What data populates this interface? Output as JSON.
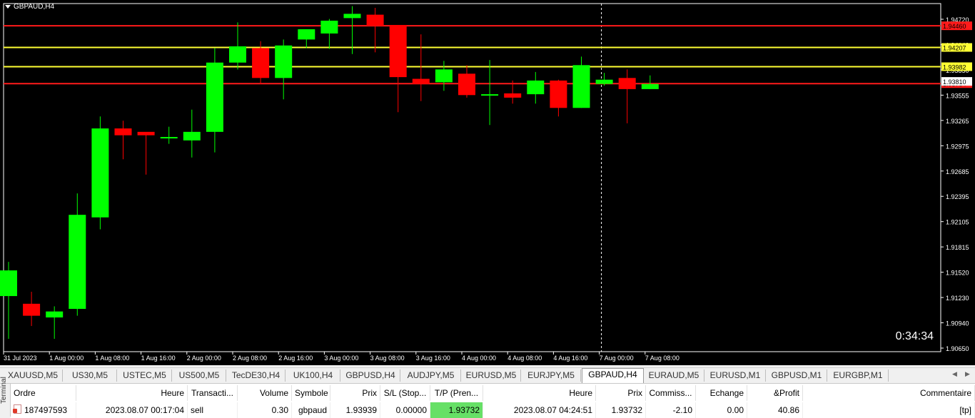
{
  "chart": {
    "symbol_title": "GBPAUD,H4",
    "countdown": "0:34:34",
    "colors": {
      "background": "#000000",
      "bull": "#00ff00",
      "bear": "#ff0000",
      "grid": "#ffffff",
      "red_line": "#ff1a1a",
      "yellow_line": "#ffff33"
    }
  },
  "chart_data": {
    "type": "candlestick",
    "price_min": 1.9065,
    "price_max": 1.9472,
    "y_ticks": [
      "1.94720",
      "1.94140",
      "1.93850",
      "1.93555",
      "1.93265",
      "1.92975",
      "1.92685",
      "1.92395",
      "1.92105",
      "1.91815",
      "1.91520",
      "1.91230",
      "1.90940",
      "1.90650"
    ],
    "x_labels": [
      "31 Jul 2023",
      "1 Aug 00:00",
      "1 Aug 08:00",
      "1 Aug 16:00",
      "2 Aug 00:00",
      "2 Aug 08:00",
      "2 Aug 16:00",
      "3 Aug 00:00",
      "3 Aug 08:00",
      "3 Aug 16:00",
      "4 Aug 00:00",
      "4 Aug 08:00",
      "4 Aug 16:00",
      "7 Aug 00:00",
      "7 Aug 08:00"
    ],
    "candles": [
      {
        "o": 1.913,
        "h": 1.917,
        "l": 1.908,
        "c": 1.916
      },
      {
        "o": 1.9121,
        "h": 1.9135,
        "l": 1.9095,
        "c": 1.9107
      },
      {
        "o": 1.9105,
        "h": 1.9118,
        "l": 1.908,
        "c": 1.9112
      },
      {
        "o": 1.9115,
        "h": 1.925,
        "l": 1.9107,
        "c": 1.9225
      },
      {
        "o": 1.9222,
        "h": 1.934,
        "l": 1.9208,
        "c": 1.9326
      },
      {
        "o": 1.9326,
        "h": 1.9335,
        "l": 1.929,
        "c": 1.9318
      },
      {
        "o": 1.9322,
        "h": 1.932,
        "l": 1.9272,
        "c": 1.9318
      },
      {
        "o": 1.9315,
        "h": 1.9328,
        "l": 1.9308,
        "c": 1.9316
      },
      {
        "o": 1.9312,
        "h": 1.9348,
        "l": 1.9292,
        "c": 1.9322
      },
      {
        "o": 1.9322,
        "h": 1.942,
        "l": 1.9298,
        "c": 1.9403
      },
      {
        "o": 1.9403,
        "h": 1.945,
        "l": 1.9395,
        "c": 1.9422
      },
      {
        "o": 1.942,
        "h": 1.9428,
        "l": 1.9378,
        "c": 1.9385
      },
      {
        "o": 1.9385,
        "h": 1.943,
        "l": 1.936,
        "c": 1.9423
      },
      {
        "o": 1.943,
        "h": 1.9441,
        "l": 1.942,
        "c": 1.9442
      },
      {
        "o": 1.9437,
        "h": 1.9454,
        "l": 1.9419,
        "c": 1.9452
      },
      {
        "o": 1.9455,
        "h": 1.9469,
        "l": 1.9413,
        "c": 1.946
      },
      {
        "o": 1.9459,
        "h": 1.9467,
        "l": 1.9415,
        "c": 1.9446
      },
      {
        "o": 1.9447,
        "h": 1.9447,
        "l": 1.9345,
        "c": 1.9386
      },
      {
        "o": 1.9384,
        "h": 1.9436,
        "l": 1.9358,
        "c": 1.9378
      },
      {
        "o": 1.938,
        "h": 1.9405,
        "l": 1.937,
        "c": 1.9395
      },
      {
        "o": 1.939,
        "h": 1.94,
        "l": 1.9362,
        "c": 1.9365
      },
      {
        "o": 1.9365,
        "h": 1.9406,
        "l": 1.933,
        "c": 1.9366
      },
      {
        "o": 1.9367,
        "h": 1.9382,
        "l": 1.9355,
        "c": 1.9362
      },
      {
        "o": 1.9366,
        "h": 1.9392,
        "l": 1.9355,
        "c": 1.9382
      },
      {
        "o": 1.9382,
        "h": 1.9383,
        "l": 1.934,
        "c": 1.935
      },
      {
        "o": 1.935,
        "h": 1.941,
        "l": 1.935,
        "c": 1.94
      },
      {
        "o": 1.9378,
        "h": 1.9391,
        "l": 1.9376,
        "c": 1.9383
      },
      {
        "o": 1.9385,
        "h": 1.9395,
        "l": 1.9332,
        "c": 1.9372
      },
      {
        "o": 1.9372,
        "h": 1.9388,
        "l": 1.9372,
        "c": 1.9378
      }
    ],
    "h_lines": [
      {
        "price": 1.9446,
        "label": "1.94460",
        "color": "#ff1a1a",
        "label_bg": "#ff1a1a",
        "label_fg": "#000000"
      },
      {
        "price": 1.94207,
        "label": "1.94207",
        "color": "#ffff33",
        "label_bg": "#ffff33",
        "label_fg": "#000000"
      },
      {
        "price": 1.93982,
        "label": "1.93982",
        "color": "#ffff33",
        "label_bg": "#ffff33",
        "label_fg": "#000000"
      },
      {
        "price": 1.93784,
        "label": "1.93784",
        "color": "#ff1a1a",
        "label_bg": "#ff1a1a",
        "label_fg": "#000000"
      },
      {
        "price": 1.9381,
        "label": "1.93810",
        "color": "#ffffff",
        "label_bg": "#ffffff",
        "label_fg": "#000000"
      }
    ],
    "crosshair_index": 26
  },
  "tabs": [
    {
      "label": "XAUUSD,M5"
    },
    {
      "label": "US30,M5"
    },
    {
      "label": "USTEC,M5"
    },
    {
      "label": "US500,M5"
    },
    {
      "label": "TecDE30,H4"
    },
    {
      "label": "UK100,H4"
    },
    {
      "label": "GBPUSD,H4"
    },
    {
      "label": "AUDJPY,M5"
    },
    {
      "label": "EURUSD,M5"
    },
    {
      "label": "EURJPY,M5"
    },
    {
      "label": "GBPAUD,H4",
      "active": true
    },
    {
      "label": "EURAUD,M5"
    },
    {
      "label": "EURUSD,M1"
    },
    {
      "label": "GBPUSD,M1"
    },
    {
      "label": "EURGBP,M1"
    }
  ],
  "terminal": {
    "side_label": "Terminal",
    "columns": [
      "Ordre",
      "Heure",
      "Transacti...",
      "Volume",
      "Symbole",
      "Prix",
      "S/L (Stop...",
      "T/P (Pren...",
      "Heure",
      "Prix",
      "Commiss...",
      "Echange",
      "&Profit",
      "Commentaire"
    ],
    "rows": [
      [
        "187497593",
        "2023.08.07 00:17:04",
        "sell",
        "0.30",
        "gbpaud",
        "1.93939",
        "0.00000",
        "1.93732",
        "2023.08.07 04:24:51",
        "1.93732",
        "-2.10",
        "0.00",
        "40.86",
        "[tp]"
      ]
    ]
  }
}
